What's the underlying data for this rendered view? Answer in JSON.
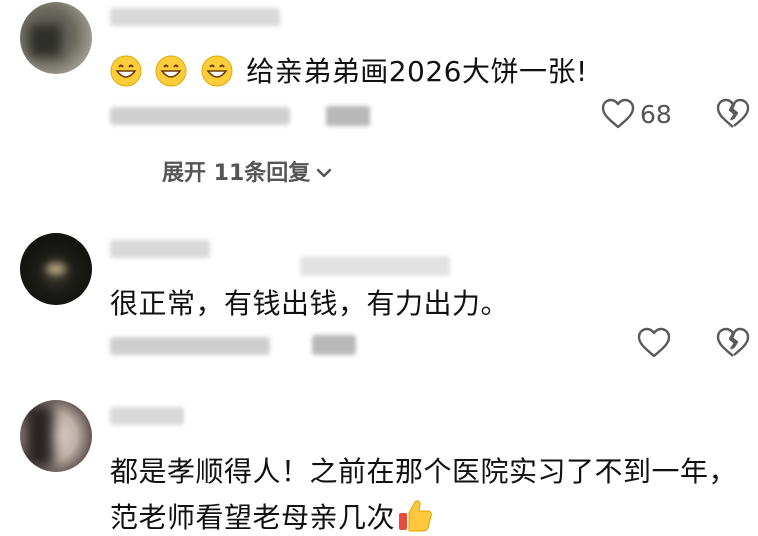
{
  "comments": [
    {
      "text": "给亲弟弟画2026大饼一张!",
      "emoji": "grinning-face-icon",
      "like_count": "68",
      "expand_replies": "展开 11条回复"
    },
    {
      "text": "很正常，有钱出钱，有力出力。"
    },
    {
      "text_line1": "都是孝顺得人！之前在那个医院实习了不到一年，",
      "text_line2": "范老师看望老母亲几次"
    }
  ]
}
